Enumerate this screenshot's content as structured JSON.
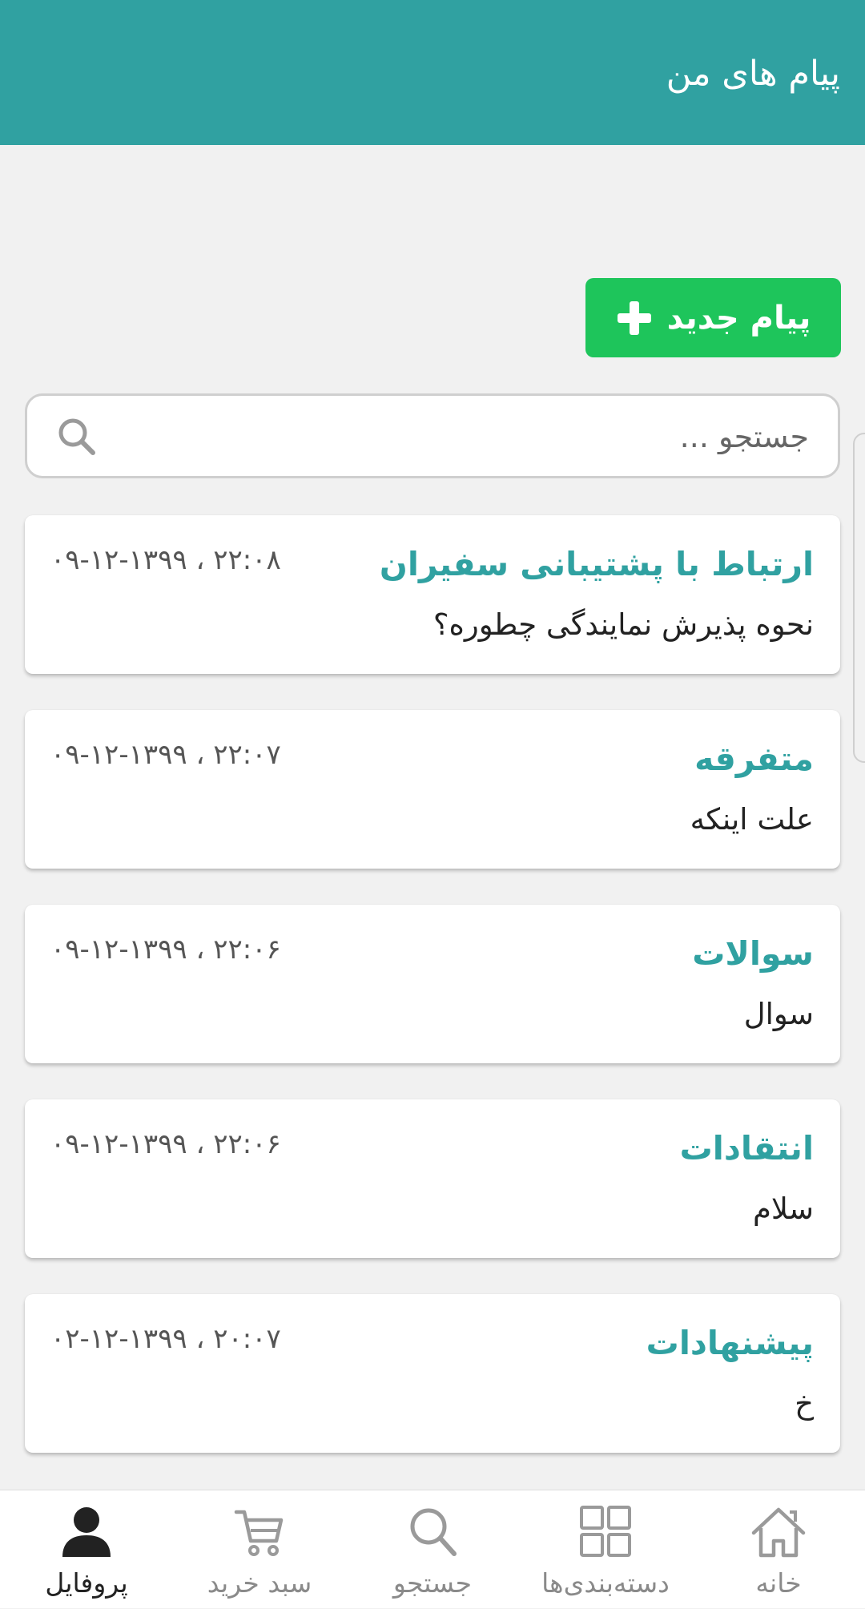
{
  "header": {
    "title": "پیام های من"
  },
  "new_message_button": {
    "label": "پیام جدید",
    "icon": "plus-icon"
  },
  "search": {
    "placeholder": "جستجو ...",
    "value": "",
    "icon": "search-icon"
  },
  "messages": [
    {
      "title": "ارتباط با پشتیبانی سفیران",
      "date": "۲۲:۰۸ ، ۰۹-۱۲-۱۳۹۹",
      "body": "نحوه پذیرش نمایندگی چطوره؟"
    },
    {
      "title": "متفرقه",
      "date": "۲۲:۰۷ ، ۰۹-۱۲-۱۳۹۹",
      "body": "علت اینکه"
    },
    {
      "title": "سوالات",
      "date": "۲۲:۰۶ ، ۰۹-۱۲-۱۳۹۹",
      "body": "سوال"
    },
    {
      "title": "انتقادات",
      "date": "۲۲:۰۶ ، ۰۹-۱۲-۱۳۹۹",
      "body": "سلام"
    },
    {
      "title": "پیشنهادات",
      "date": "۲۰:۰۷ ، ۰۲-۱۲-۱۳۹۹",
      "body": "خ"
    }
  ],
  "bottom_nav": {
    "items": [
      {
        "label": "پروفایل",
        "icon": "user-icon",
        "active": true
      },
      {
        "label": "سبد خرید",
        "icon": "cart-icon",
        "active": false
      },
      {
        "label": "جستجو",
        "icon": "search-icon",
        "active": false
      },
      {
        "label": "دسته‌بندی‌ها",
        "icon": "grid-icon",
        "active": false
      },
      {
        "label": "خانه",
        "icon": "home-icon",
        "active": false
      }
    ]
  },
  "colors": {
    "header": "#30a1a1",
    "accent": "#30a1a1",
    "button": "#1ec55b",
    "background": "#f1f1f1"
  }
}
